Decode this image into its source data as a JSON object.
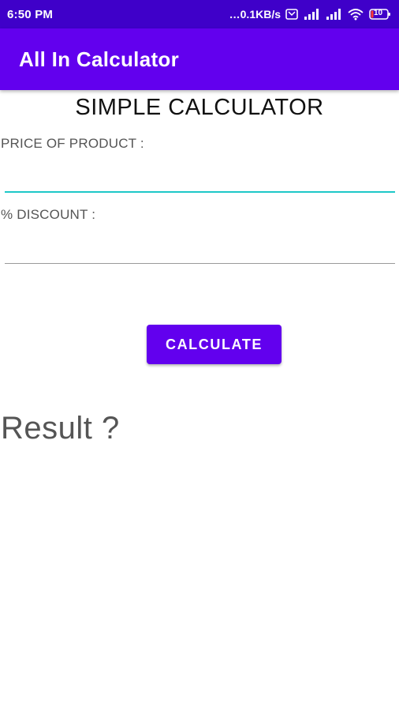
{
  "status_bar": {
    "time": "6:50 PM",
    "network_speed": "…0.1KB/s",
    "battery_level": "10",
    "icons": [
      "notification-icon",
      "signal-icon",
      "signal-icon",
      "wifi-icon",
      "battery-icon"
    ]
  },
  "app_bar": {
    "title": "All In Calculator",
    "color": "#6200ee",
    "status_color": "#3f00c9"
  },
  "form": {
    "heading": "SIMPLE CALCULATOR",
    "price_label": "PRICE OF PRODUCT :",
    "price_value": "",
    "discount_label": "% DISCOUNT :",
    "discount_value": "",
    "calculate_label": "CALCULATE",
    "focused_underline_color": "#1ec8c8"
  },
  "result": {
    "text": "Result ?"
  }
}
